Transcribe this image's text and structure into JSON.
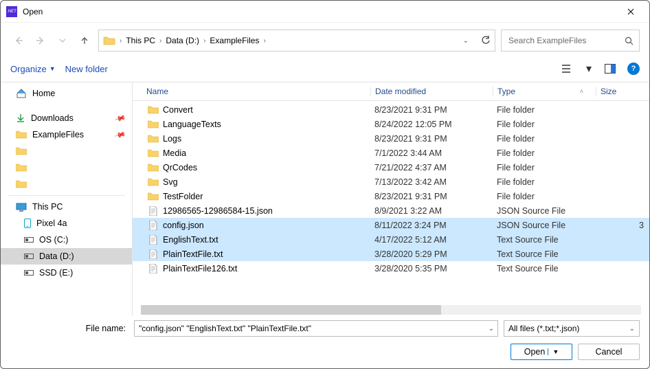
{
  "window": {
    "title": "Open",
    "app_badge": ".NET"
  },
  "nav": {
    "breadcrumb": [
      "This PC",
      "Data (D:)",
      "ExampleFiles"
    ],
    "search_placeholder": "Search ExampleFiles"
  },
  "toolbar": {
    "organize": "Organize",
    "new_folder": "New folder"
  },
  "sidebar": {
    "home": "Home",
    "downloads": "Downloads",
    "examplefiles": "ExampleFiles",
    "this_pc": "This PC",
    "pixel": "Pixel 4a",
    "os": "OS (C:)",
    "data": "Data (D:)",
    "ssd": "SSD (E:)"
  },
  "columns": {
    "name": "Name",
    "date": "Date modified",
    "type": "Type",
    "size": "Size"
  },
  "files": [
    {
      "name": "Convert",
      "date": "8/23/2021 9:31 PM",
      "type": "File folder",
      "kind": "folder",
      "selected": false
    },
    {
      "name": "LanguageTexts",
      "date": "8/24/2022 12:05 PM",
      "type": "File folder",
      "kind": "folder",
      "selected": false
    },
    {
      "name": "Logs",
      "date": "8/23/2021 9:31 PM",
      "type": "File folder",
      "kind": "folder",
      "selected": false
    },
    {
      "name": "Media",
      "date": "7/1/2022 3:44 AM",
      "type": "File folder",
      "kind": "folder",
      "selected": false
    },
    {
      "name": "QrCodes",
      "date": "7/21/2022 4:37 AM",
      "type": "File folder",
      "kind": "folder",
      "selected": false
    },
    {
      "name": "Svg",
      "date": "7/13/2022 3:42 AM",
      "type": "File folder",
      "kind": "folder",
      "selected": false
    },
    {
      "name": "TestFolder",
      "date": "8/23/2021 9:31 PM",
      "type": "File folder",
      "kind": "folder",
      "selected": false
    },
    {
      "name": "12986565-12986584-15.json",
      "date": "8/9/2021 3:22 AM",
      "type": "JSON Source File",
      "kind": "json",
      "selected": false
    },
    {
      "name": "config.json",
      "date": "8/11/2022 3:24 PM",
      "type": "JSON Source File",
      "kind": "json",
      "selected": true,
      "size": "3"
    },
    {
      "name": "EnglishText.txt",
      "date": "4/17/2022 5:12 AM",
      "type": "Text Source File",
      "kind": "txt",
      "selected": true
    },
    {
      "name": "PlainTextFile.txt",
      "date": "3/28/2020 5:29 PM",
      "type": "Text Source File",
      "kind": "txt",
      "selected": true
    },
    {
      "name": "PlainTextFile126.txt",
      "date": "3/28/2020 5:35 PM",
      "type": "Text Source File",
      "kind": "txt",
      "selected": false
    }
  ],
  "footer": {
    "filename_label": "File name:",
    "filename_value": "\"config.json\" \"EnglishText.txt\" \"PlainTextFile.txt\"",
    "filter": "All files (*.txt;*.json)",
    "open": "Open",
    "cancel": "Cancel"
  }
}
